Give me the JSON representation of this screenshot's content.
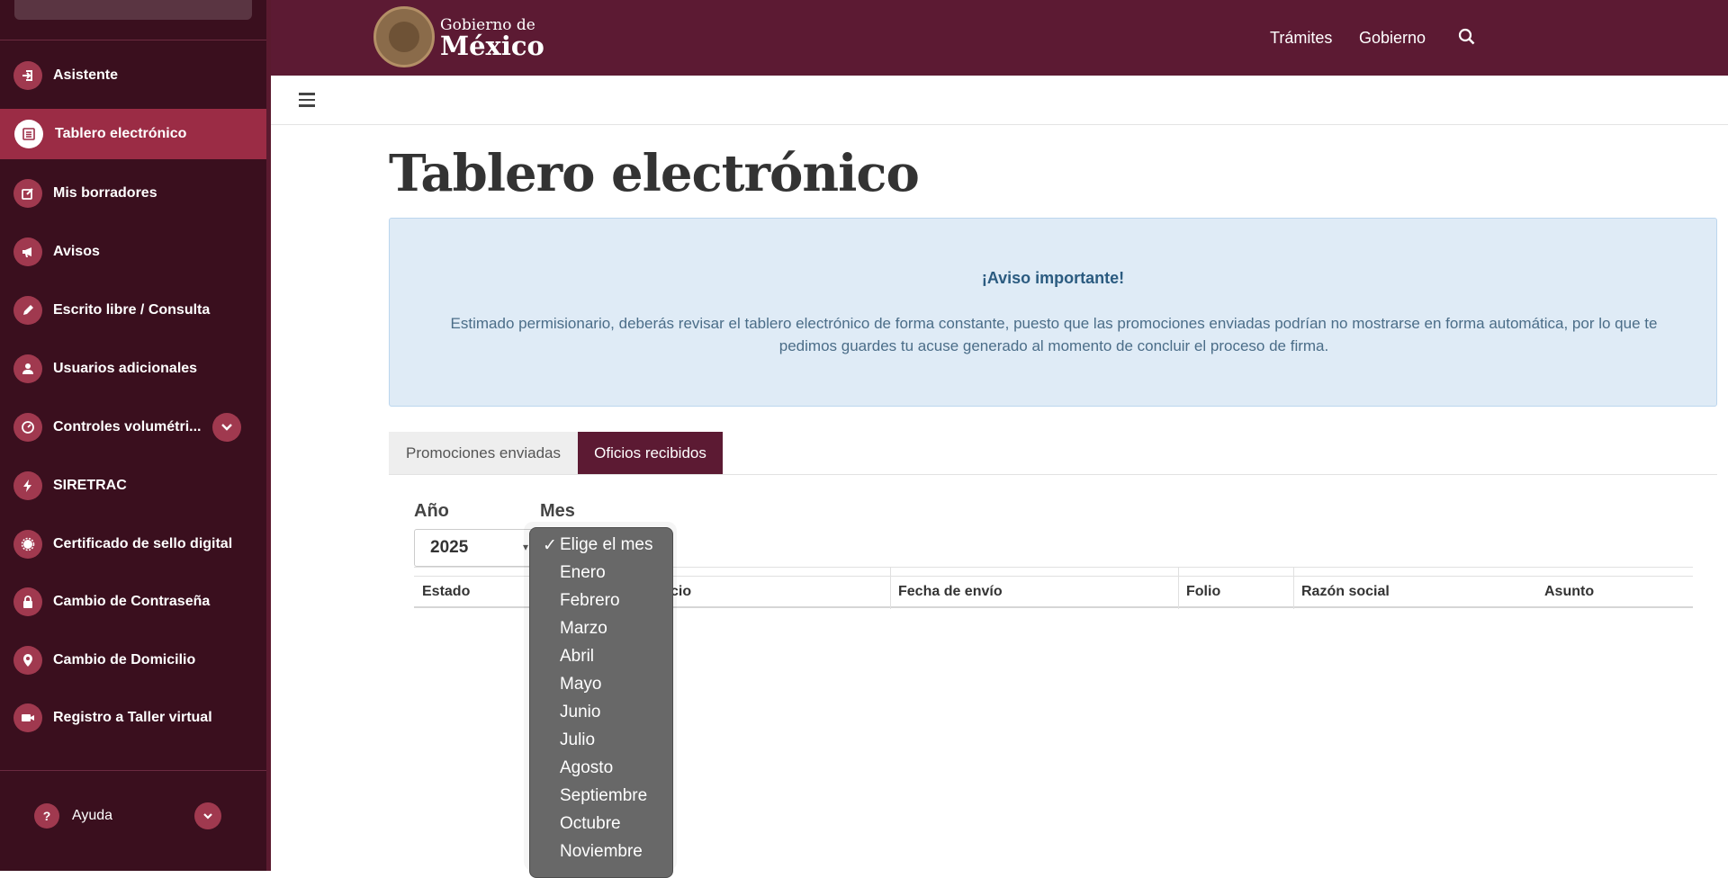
{
  "sidebar": {
    "items": [
      {
        "label": "Asistente",
        "icon": "sign-in-icon"
      },
      {
        "label": "Tablero electrónico",
        "icon": "list-icon"
      },
      {
        "label": "Mis borradores",
        "icon": "edit-icon"
      },
      {
        "label": "Avisos",
        "icon": "megaphone-icon"
      },
      {
        "label": "Escrito libre / Consulta",
        "icon": "pencil-icon"
      },
      {
        "label": "Usuarios adicionales",
        "icon": "user-icon"
      },
      {
        "label": "Controles volumétri...",
        "icon": "gauge-icon"
      },
      {
        "label": "SIRETRAC",
        "icon": "bolt-icon"
      },
      {
        "label": "Certificado de sello digital",
        "icon": "certificate-icon"
      },
      {
        "label": "Cambio de Contraseña",
        "icon": "lock-icon"
      },
      {
        "label": "Cambio de Domicilio",
        "icon": "map-pin-icon"
      },
      {
        "label": "Registro a Taller virtual",
        "icon": "video-icon"
      }
    ],
    "active_item": "Tablero electrónico",
    "help_label": "Ayuda",
    "help_icon_glyph": "?"
  },
  "header": {
    "brand_small": "Gobierno de",
    "brand_big": "México",
    "links": [
      "Trámites",
      "Gobierno"
    ]
  },
  "main": {
    "title": "Tablero electrónico",
    "notice": {
      "title": "¡Aviso importante!",
      "text": "Estimado permisionario, deberás revisar el tablero electrónico de forma constante, puesto que las promociones enviadas podrían no mostrarse en forma automática, por lo que te pedimos guardes tu acuse generado al momento de concluir el proceso de firma."
    },
    "tabs": [
      {
        "label": "Promociones enviadas",
        "active": false
      },
      {
        "label": "Oficios recibidos",
        "active": true
      }
    ],
    "filters": {
      "year_label": "Año",
      "year_value": "2025",
      "month_label": "Mes"
    },
    "table": {
      "headers": [
        "Estado",
        "cio",
        "Fecha de envío",
        "Folio",
        "Razón social",
        "Asunto"
      ]
    },
    "month_dropdown": {
      "selected": "Elige el mes",
      "check_glyph": "✓",
      "options": [
        "Elige el mes",
        "Enero",
        "Febrero",
        "Marzo",
        "Abril",
        "Mayo",
        "Junio",
        "Julio",
        "Agosto",
        "Septiembre",
        "Octubre",
        "Noviembre"
      ]
    }
  },
  "colors": {
    "brand": "#5c1a33",
    "sidebar_bg": "#3a0f1e",
    "sidebar_active": "#9b2c45",
    "notice_bg": "#dfebf6"
  }
}
